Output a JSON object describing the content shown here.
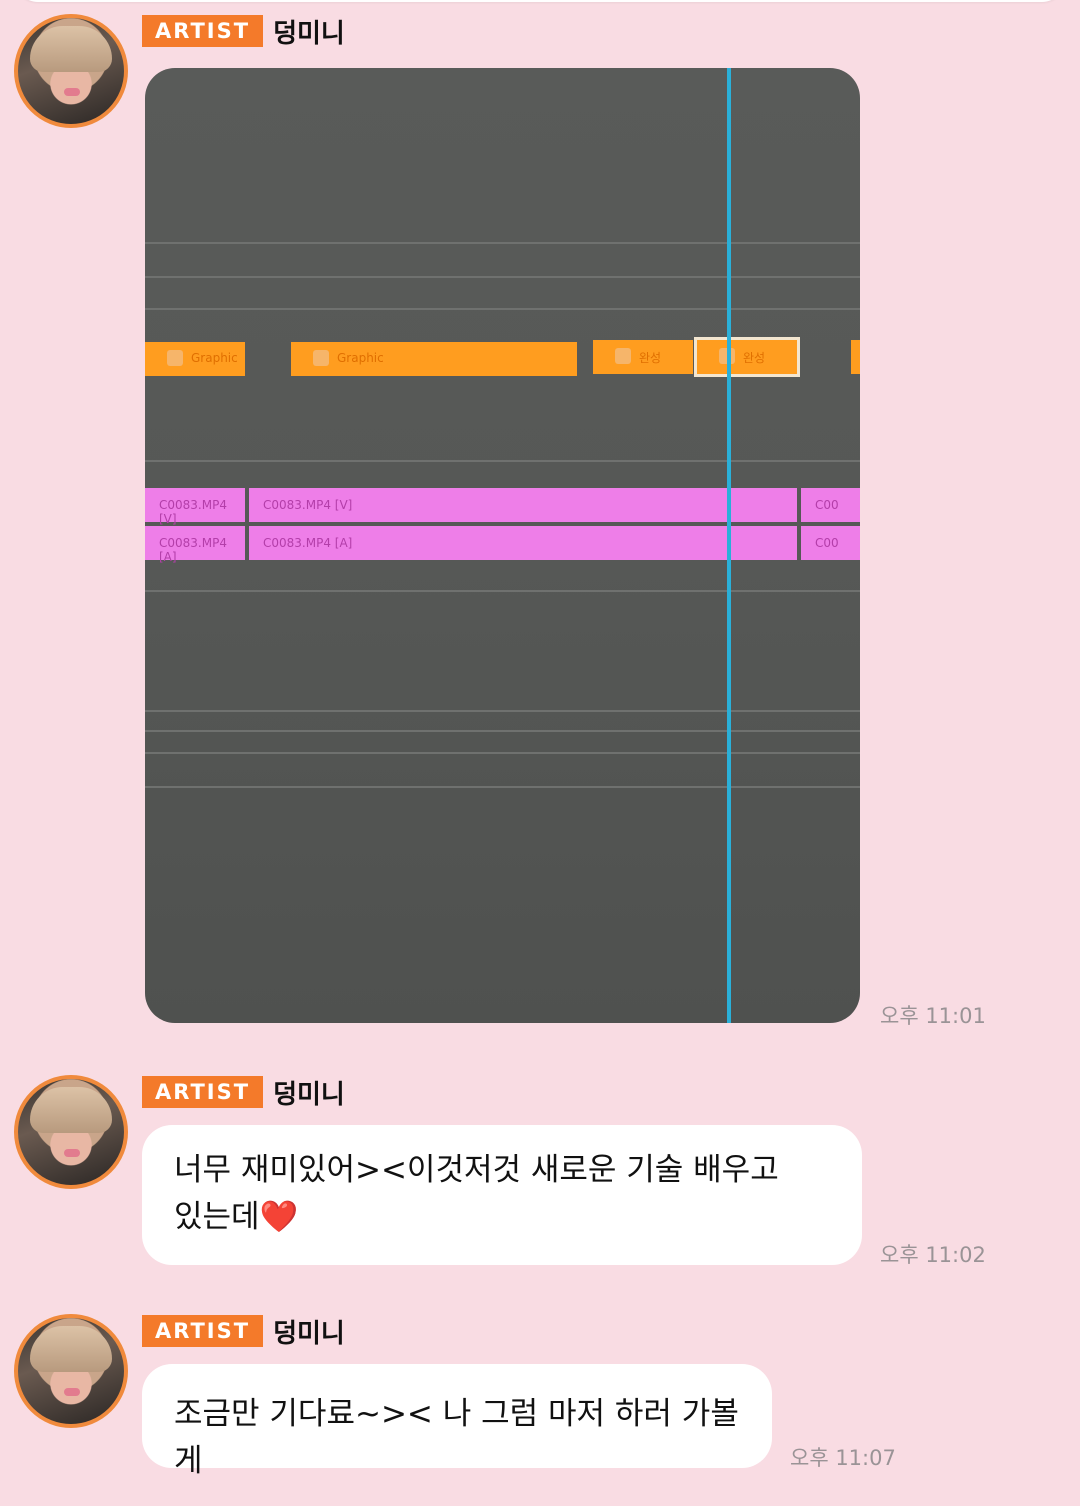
{
  "messages": [
    {
      "badge": "ARTIST",
      "sender": "덩미니",
      "time": "오후 11:01",
      "photo": {
        "clips_graphic": [
          "Graphic",
          "Graphic",
          "완성",
          "완성"
        ],
        "clips_video": [
          "C0083.MP4 [V]",
          "C0083.MP4 [V]",
          "C00"
        ],
        "clips_audio": [
          "C0083.MP4 [A]",
          "C0083.MP4 [A]",
          "C00"
        ]
      }
    },
    {
      "badge": "ARTIST",
      "sender": "덩미니",
      "time": "오후 11:02",
      "text_line1": "너무 재미있어><이것저것 새로운 기술 배우고",
      "text_line2": "있는데",
      "emoji": "❤️"
    },
    {
      "badge": "ARTIST",
      "sender": "덩미니",
      "time": "오후 11:07",
      "text": "조금만 기다료~>< 나 그럼 마저 하러 가볼게"
    }
  ],
  "colors": {
    "background": "#f9dce3",
    "badge": "#f47a2a",
    "avatar_ring": "#f08a3c"
  }
}
